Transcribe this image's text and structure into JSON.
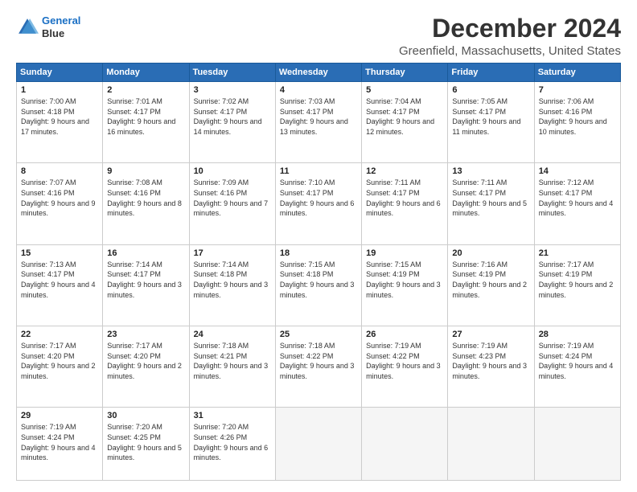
{
  "logo": {
    "line1": "General",
    "line2": "Blue"
  },
  "title": "December 2024",
  "subtitle": "Greenfield, Massachusetts, United States",
  "days_of_week": [
    "Sunday",
    "Monday",
    "Tuesday",
    "Wednesday",
    "Thursday",
    "Friday",
    "Saturday"
  ],
  "weeks": [
    [
      {
        "day": 1,
        "sunrise": "7:00 AM",
        "sunset": "4:18 PM",
        "daylight": "9 hours and 17 minutes."
      },
      {
        "day": 2,
        "sunrise": "7:01 AM",
        "sunset": "4:17 PM",
        "daylight": "9 hours and 16 minutes."
      },
      {
        "day": 3,
        "sunrise": "7:02 AM",
        "sunset": "4:17 PM",
        "daylight": "9 hours and 14 minutes."
      },
      {
        "day": 4,
        "sunrise": "7:03 AM",
        "sunset": "4:17 PM",
        "daylight": "9 hours and 13 minutes."
      },
      {
        "day": 5,
        "sunrise": "7:04 AM",
        "sunset": "4:17 PM",
        "daylight": "9 hours and 12 minutes."
      },
      {
        "day": 6,
        "sunrise": "7:05 AM",
        "sunset": "4:17 PM",
        "daylight": "9 hours and 11 minutes."
      },
      {
        "day": 7,
        "sunrise": "7:06 AM",
        "sunset": "4:16 PM",
        "daylight": "9 hours and 10 minutes."
      }
    ],
    [
      {
        "day": 8,
        "sunrise": "7:07 AM",
        "sunset": "4:16 PM",
        "daylight": "9 hours and 9 minutes."
      },
      {
        "day": 9,
        "sunrise": "7:08 AM",
        "sunset": "4:16 PM",
        "daylight": "9 hours and 8 minutes."
      },
      {
        "day": 10,
        "sunrise": "7:09 AM",
        "sunset": "4:16 PM",
        "daylight": "9 hours and 7 minutes."
      },
      {
        "day": 11,
        "sunrise": "7:10 AM",
        "sunset": "4:17 PM",
        "daylight": "9 hours and 6 minutes."
      },
      {
        "day": 12,
        "sunrise": "7:11 AM",
        "sunset": "4:17 PM",
        "daylight": "9 hours and 6 minutes."
      },
      {
        "day": 13,
        "sunrise": "7:11 AM",
        "sunset": "4:17 PM",
        "daylight": "9 hours and 5 minutes."
      },
      {
        "day": 14,
        "sunrise": "7:12 AM",
        "sunset": "4:17 PM",
        "daylight": "9 hours and 4 minutes."
      }
    ],
    [
      {
        "day": 15,
        "sunrise": "7:13 AM",
        "sunset": "4:17 PM",
        "daylight": "9 hours and 4 minutes."
      },
      {
        "day": 16,
        "sunrise": "7:14 AM",
        "sunset": "4:17 PM",
        "daylight": "9 hours and 3 minutes."
      },
      {
        "day": 17,
        "sunrise": "7:14 AM",
        "sunset": "4:18 PM",
        "daylight": "9 hours and 3 minutes."
      },
      {
        "day": 18,
        "sunrise": "7:15 AM",
        "sunset": "4:18 PM",
        "daylight": "9 hours and 3 minutes."
      },
      {
        "day": 19,
        "sunrise": "7:15 AM",
        "sunset": "4:19 PM",
        "daylight": "9 hours and 3 minutes."
      },
      {
        "day": 20,
        "sunrise": "7:16 AM",
        "sunset": "4:19 PM",
        "daylight": "9 hours and 2 minutes."
      },
      {
        "day": 21,
        "sunrise": "7:17 AM",
        "sunset": "4:19 PM",
        "daylight": "9 hours and 2 minutes."
      }
    ],
    [
      {
        "day": 22,
        "sunrise": "7:17 AM",
        "sunset": "4:20 PM",
        "daylight": "9 hours and 2 minutes."
      },
      {
        "day": 23,
        "sunrise": "7:17 AM",
        "sunset": "4:20 PM",
        "daylight": "9 hours and 2 minutes."
      },
      {
        "day": 24,
        "sunrise": "7:18 AM",
        "sunset": "4:21 PM",
        "daylight": "9 hours and 3 minutes."
      },
      {
        "day": 25,
        "sunrise": "7:18 AM",
        "sunset": "4:22 PM",
        "daylight": "9 hours and 3 minutes."
      },
      {
        "day": 26,
        "sunrise": "7:19 AM",
        "sunset": "4:22 PM",
        "daylight": "9 hours and 3 minutes."
      },
      {
        "day": 27,
        "sunrise": "7:19 AM",
        "sunset": "4:23 PM",
        "daylight": "9 hours and 3 minutes."
      },
      {
        "day": 28,
        "sunrise": "7:19 AM",
        "sunset": "4:24 PM",
        "daylight": "9 hours and 4 minutes."
      }
    ],
    [
      {
        "day": 29,
        "sunrise": "7:19 AM",
        "sunset": "4:24 PM",
        "daylight": "9 hours and 4 minutes."
      },
      {
        "day": 30,
        "sunrise": "7:20 AM",
        "sunset": "4:25 PM",
        "daylight": "9 hours and 5 minutes."
      },
      {
        "day": 31,
        "sunrise": "7:20 AM",
        "sunset": "4:26 PM",
        "daylight": "9 hours and 6 minutes."
      },
      null,
      null,
      null,
      null
    ]
  ]
}
